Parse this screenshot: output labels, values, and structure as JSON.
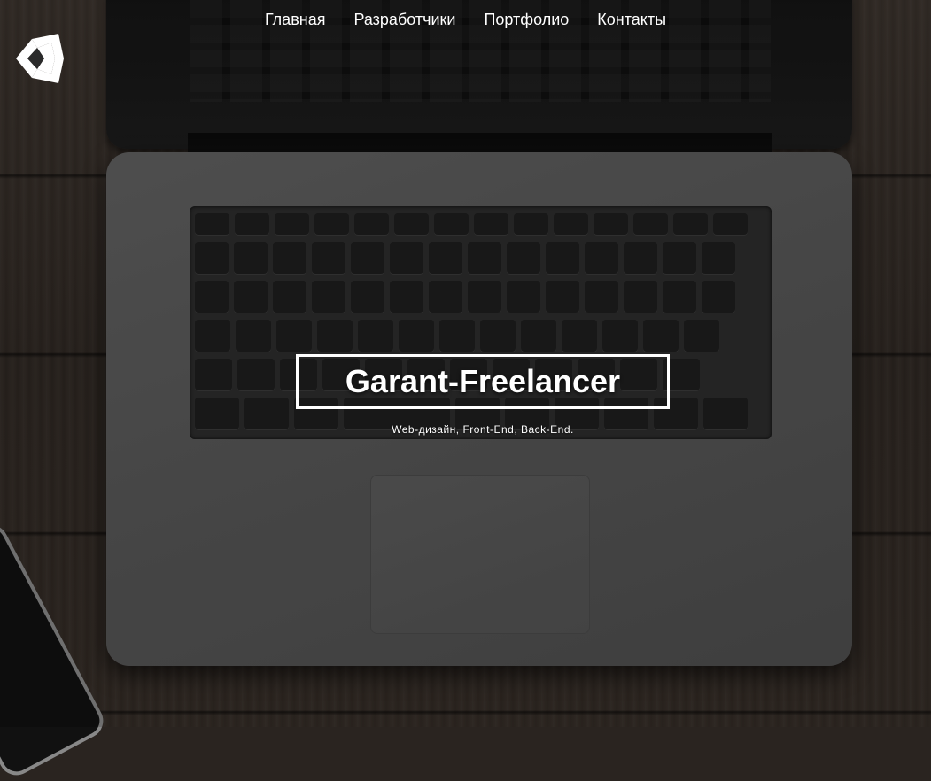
{
  "nav": {
    "items": [
      {
        "label": "Главная"
      },
      {
        "label": "Разработчики"
      },
      {
        "label": "Портфолио"
      },
      {
        "label": "Контакты"
      }
    ]
  },
  "logo": {
    "icon": "unity-logo-icon"
  },
  "hero": {
    "title": "Garant-Freelancer",
    "subtitle": "Web-дизайн, Front-End, Back-End."
  },
  "background": {
    "icon": "laptop-keyboard-photo"
  },
  "colors": {
    "text": "#ffffff",
    "frame": "#ffffff"
  }
}
